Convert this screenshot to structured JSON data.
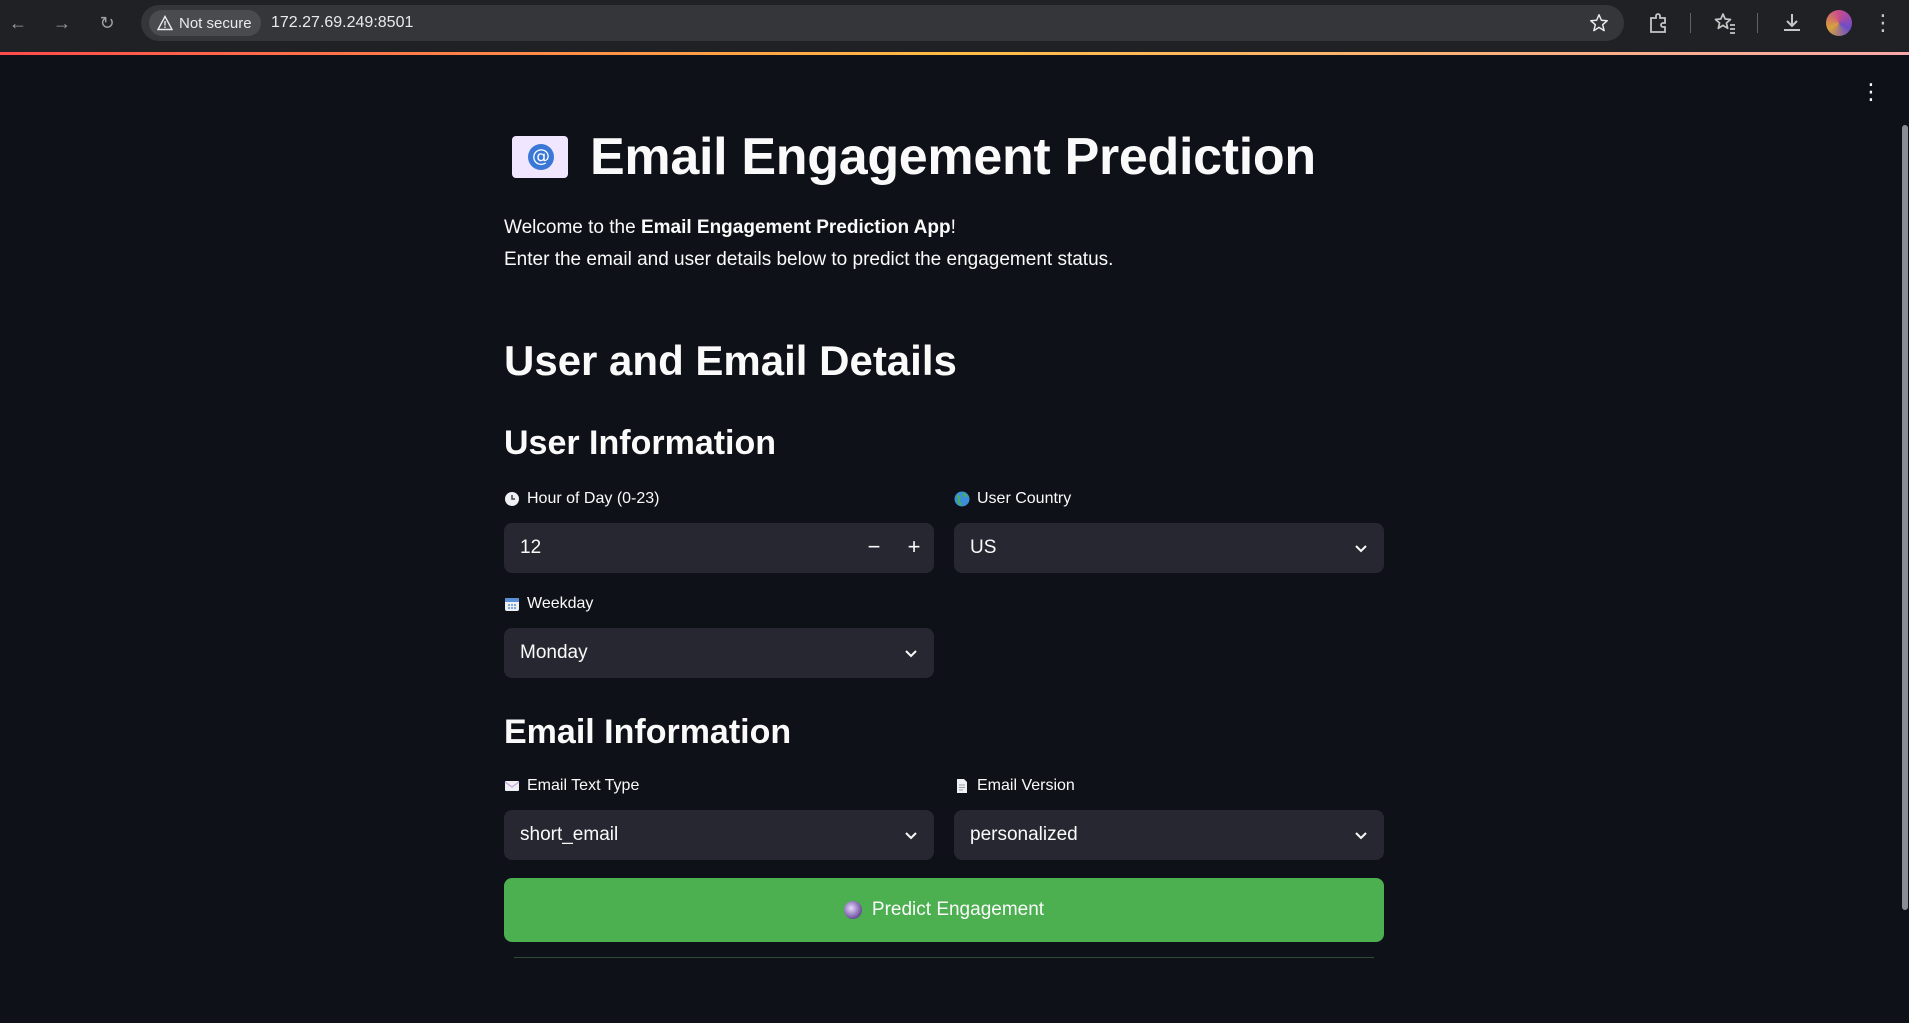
{
  "browser": {
    "security_label": "Not secure",
    "url": "172.27.69.249:8501"
  },
  "app": {
    "title": "Email Engagement Prediction",
    "title_icon": "envelope-with-at-icon",
    "intro_prefix": "Welcome to the ",
    "intro_bold": "Email Engagement Prediction App",
    "intro_suffix": "!",
    "intro_line2": "Enter the email and user details below to predict the engagement status.",
    "section_heading": "User and Email Details",
    "user_section": {
      "heading": "User Information",
      "hour": {
        "label": "Hour of Day (0-23)",
        "icon": "clock-icon",
        "value": "12",
        "minus": "−",
        "plus": "+"
      },
      "country": {
        "label": "User Country",
        "icon": "globe-icon",
        "value": "US"
      },
      "weekday": {
        "label": "Weekday",
        "icon": "calendar-icon",
        "value": "Monday"
      }
    },
    "email_section": {
      "heading": "Email Information",
      "text_type": {
        "label": "Email Text Type",
        "icon": "envelope-icon",
        "value": "short_email"
      },
      "version": {
        "label": "Email Version",
        "icon": "document-icon",
        "value": "personalized"
      }
    },
    "predict_button": {
      "label": "Predict Engagement",
      "icon": "crystal-ball-icon",
      "color": "#4caf50"
    },
    "colors": {
      "background": "#0e1117",
      "input_bg": "#262730",
      "accent": "#ff4b4b"
    }
  }
}
